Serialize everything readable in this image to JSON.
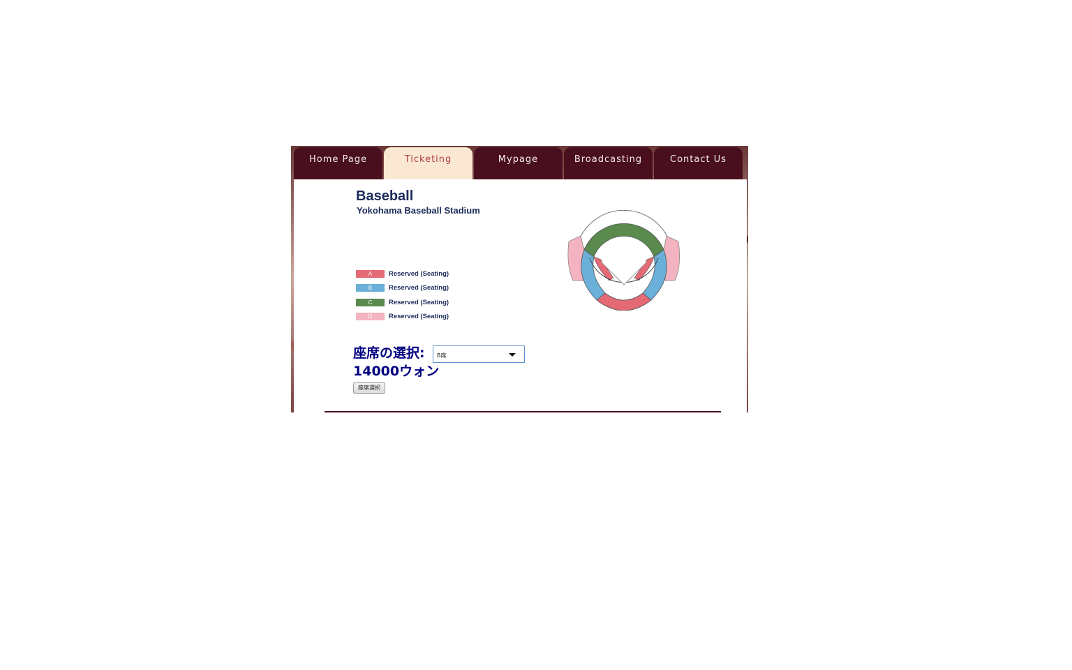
{
  "nav": {
    "tabs": [
      {
        "label": "Home Page",
        "active": false
      },
      {
        "label": "Ticketing",
        "active": true
      },
      {
        "label": "Mypage",
        "active": false
      },
      {
        "label": "Broadcasting",
        "active": false
      },
      {
        "label": "Contact Us",
        "active": false
      }
    ]
  },
  "header": {
    "title": "Baseball",
    "subtitle": "Yokohama Baseball Stadium"
  },
  "legend": [
    {
      "code": "A",
      "label": "Reserved (Seating)",
      "color": "#e46a76"
    },
    {
      "code": "B",
      "label": "Reserved (Seating)",
      "color": "#6ab0d8"
    },
    {
      "code": "C",
      "label": "Reserved (Seating)",
      "color": "#5a8a4e"
    },
    {
      "code": "D",
      "label": "Reserved (Seating)",
      "color": "#f4b3c0"
    }
  ],
  "seat_selection": {
    "label": "座席の選択:",
    "selected_value": "B席",
    "price": "14000ウォン",
    "button_label": "座席選択"
  },
  "colors": {
    "nav_bg": "#4a0f1e",
    "nav_active_bg": "#fbe8d3",
    "nav_active_text": "#b04040",
    "title_text": "#1d2c5c",
    "seat_text": "#000080"
  }
}
